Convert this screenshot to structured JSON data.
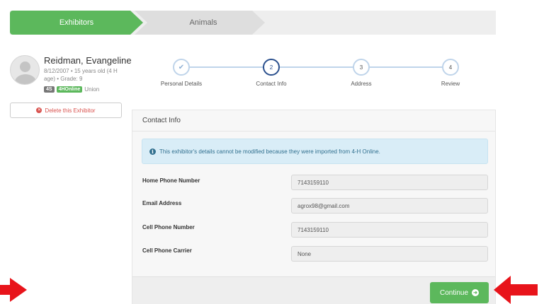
{
  "tabs": [
    {
      "label": "Exhibitors",
      "active": true
    },
    {
      "label": "Animals",
      "active": false
    }
  ],
  "exhibitor": {
    "name": "Reidman, Evangeline",
    "info": "8/12/2007 • 15 years old (4 H age) • Grade: 9",
    "badge_left": "4S",
    "badge_green": "4HOnline",
    "badge_text": "Union",
    "delete_label": "Delete this Exhibitor"
  },
  "steps": [
    {
      "number": "✔",
      "label": "Personal Details",
      "state": "done"
    },
    {
      "number": "2",
      "label": "Contact Info",
      "state": "active"
    },
    {
      "number": "3",
      "label": "Address",
      "state": "pending"
    },
    {
      "number": "4",
      "label": "Review",
      "state": "pending"
    }
  ],
  "panel": {
    "title": "Contact Info",
    "alert": "This exhibitor's details cannot be modified because they were imported from 4-H Online."
  },
  "fields": [
    {
      "label": "Home Phone Number",
      "value": "7143159110"
    },
    {
      "label": "Email Address",
      "value": "agrox98@gmail.com"
    },
    {
      "label": "Cell Phone Number",
      "value": "7143159110"
    },
    {
      "label": "Cell Phone Carrier",
      "value": "None"
    }
  ],
  "continue_label": "Continue",
  "colors": {
    "primary_green": "#5cb85c",
    "active_step": "#2a4f8d",
    "danger": "#d9534f",
    "info_bg": "#d9edf7",
    "annotation_arrow": "#e8141b"
  }
}
